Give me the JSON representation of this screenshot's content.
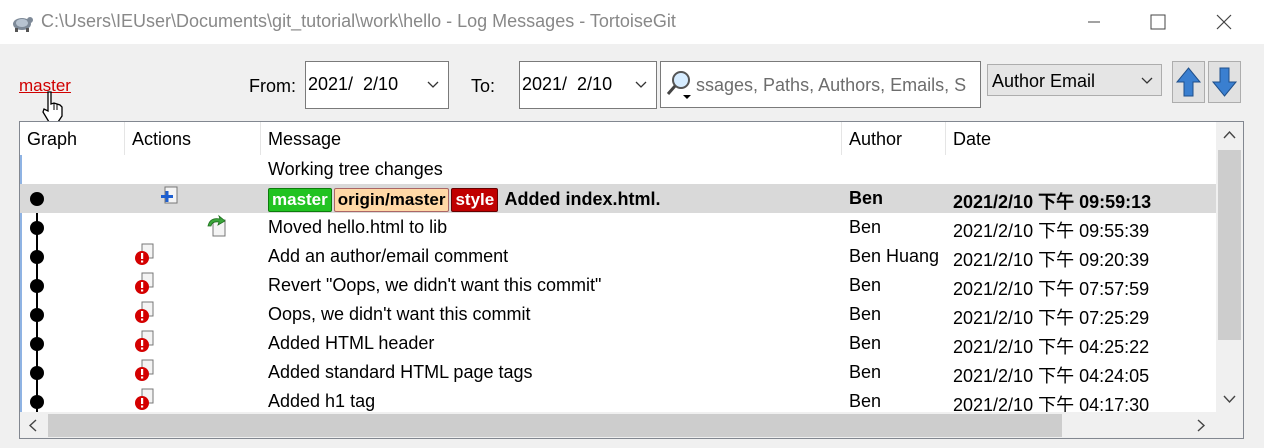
{
  "window": {
    "title": "C:\\Users\\IEUser\\Documents\\git_tutorial\\work\\hello - Log Messages - TortoiseGit",
    "app_icon": "tortoise-icon",
    "controls": [
      "minimize-icon",
      "maximize-icon",
      "close-icon"
    ]
  },
  "toolbar": {
    "branch_link": "master",
    "from_label": "From:",
    "from_date": "2021/  2/10",
    "to_label": "To:",
    "to_date": "2021/  2/10",
    "search_placeholder": "ssages, Paths, Authors, Emails, S",
    "filter_selected": "Author Email"
  },
  "table": {
    "columns": [
      "Graph",
      "Actions",
      "Message",
      "Author",
      "Date"
    ],
    "working_tree": "Working tree changes",
    "rows": [
      {
        "refs": [
          "master",
          "origin/master",
          "style"
        ],
        "message": "Added index.html.",
        "author": "Ben",
        "date": "2021/2/10 下午 09:59:13",
        "action": "add-file-icon",
        "selected": true
      },
      {
        "refs": [],
        "message": "Moved hello.html to lib",
        "author": "Ben",
        "date": "2021/2/10 下午 09:55:39",
        "action": "rename-icon"
      },
      {
        "refs": [],
        "message": "Add an author/email comment",
        "author": "Ben Huang",
        "date": "2021/2/10 下午 09:20:39",
        "action": "modified-icon"
      },
      {
        "refs": [],
        "message": "Revert \"Oops, we didn't want this commit\"",
        "author": "Ben",
        "date": "2021/2/10 下午 07:57:59",
        "action": "modified-icon"
      },
      {
        "refs": [],
        "message": "Oops, we didn't want this commit",
        "author": "Ben",
        "date": "2021/2/10 下午 07:25:29",
        "action": "modified-icon"
      },
      {
        "refs": [],
        "message": "Added HTML header",
        "author": "Ben",
        "date": "2021/2/10 下午 04:25:22",
        "action": "modified-icon"
      },
      {
        "refs": [],
        "message": "Added standard HTML page tags",
        "author": "Ben",
        "date": "2021/2/10 下午 04:24:05",
        "action": "modified-icon"
      },
      {
        "refs": [],
        "message": "Added h1 tag",
        "author": "Ben",
        "date": "2021/2/10 下午 04:17:30",
        "action": "modified-icon"
      }
    ]
  },
  "colors": {
    "branch_link": "#d00000",
    "tag_local": "#22c322",
    "tag_remote": "#ffd8a6",
    "tag_other": "#c00000",
    "selected_row": "#d9d9d9"
  }
}
